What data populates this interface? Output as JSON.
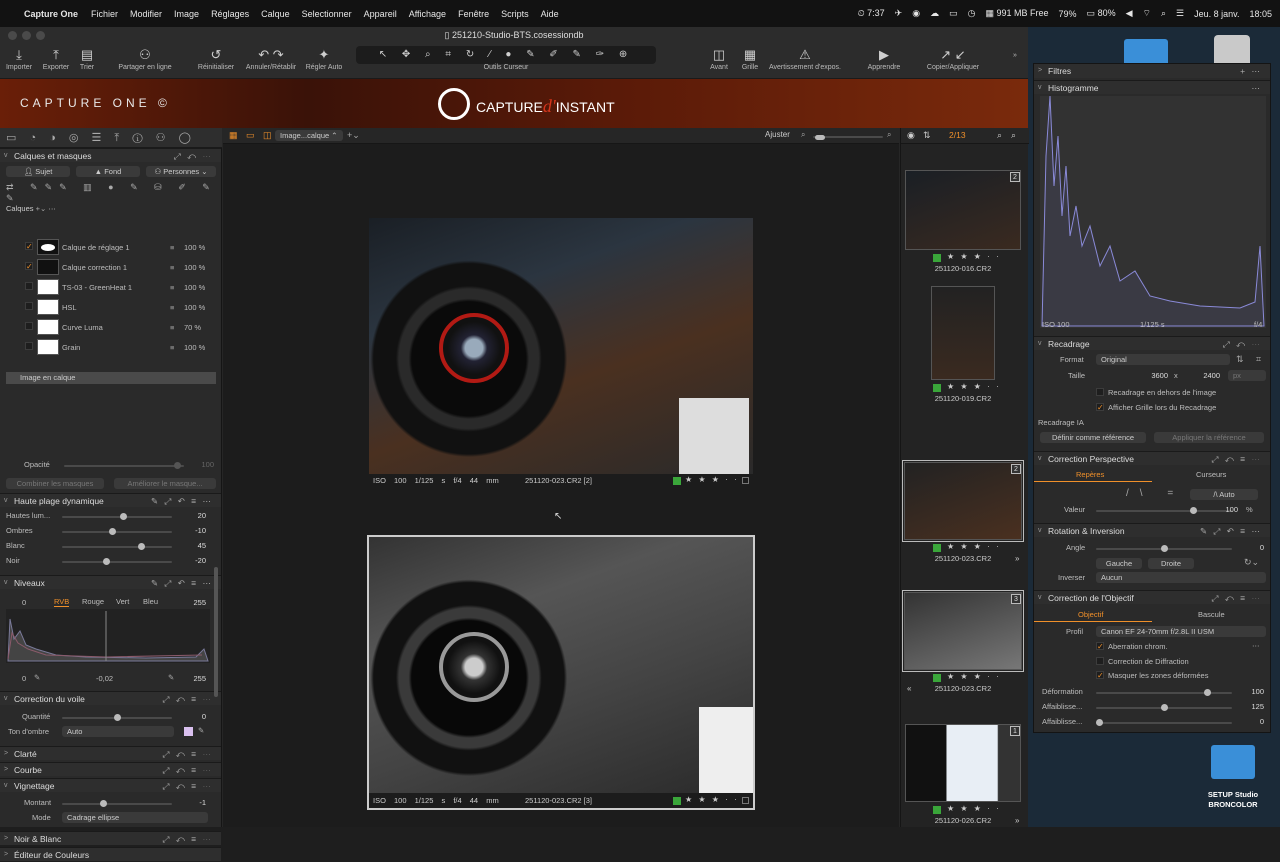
{
  "menubar": {
    "app": "Capture One",
    "items": [
      "Fichier",
      "Modifier",
      "Image",
      "Réglages",
      "Calque",
      "Selectionner",
      "Appareil",
      "Affichage",
      "Fenêtre",
      "Scripts",
      "Aide"
    ],
    "time_badge": "7:37",
    "memory": "991 MB Free",
    "cpu": "79%",
    "battery": "80%",
    "date": "Jeu. 8 janv.",
    "clock": "18:05"
  },
  "window": {
    "title": "251210-Studio-BTS.cosessiondb"
  },
  "toolbar": {
    "importer": "Importer",
    "exporter": "Exporter",
    "trier": "Trier",
    "partager": "Partager en ligne",
    "reinitialiser": "Réinitialiser",
    "annuler": "Annuler/Rétablir",
    "regler": "Régler Auto",
    "outils": "Outils Curseur",
    "avant": "Avant",
    "grille": "Grille",
    "avert": "Avertissement d'expos.",
    "apprendre": "Apprendre",
    "copier": "Copier/Appliquer"
  },
  "banner": {
    "left": "CAPTURE ONE",
    "center_a": "CAPTURE",
    "center_b": "d'",
    "center_c": "INSTANT"
  },
  "left": {
    "layers_title": "Calques et masques",
    "sujet": "Sujet",
    "fond": "Fond",
    "personnes": "Personnes",
    "calques": "Calques",
    "layers": [
      {
        "name": "Calque de réglage 1",
        "op": "100 %",
        "checked": "✓"
      },
      {
        "name": "Calque correction 1",
        "op": "100 %",
        "checked": "✓"
      },
      {
        "name": "TS-03 - GreenHeat 1",
        "op": "100 %",
        "checked": ""
      },
      {
        "name": "HSL",
        "op": "100 %",
        "checked": ""
      },
      {
        "name": "Curve Luma",
        "op": "70 %",
        "checked": ""
      },
      {
        "name": "Grain",
        "op": "100 %",
        "checked": ""
      }
    ],
    "image_layer": "Image en calque",
    "opacite": "Opacité",
    "opacite_val": "100",
    "combiner": "Combiner les masques",
    "ameliorer": "Améliorer le masque...",
    "hdr": {
      "title": "Haute plage dynamique",
      "rows": [
        {
          "label": "Hautes lum...",
          "val": "20",
          "pos": 0.55
        },
        {
          "label": "Ombres",
          "val": "-10",
          "pos": 0.45
        },
        {
          "label": "Blanc",
          "val": "45",
          "pos": 0.72
        },
        {
          "label": "Noir",
          "val": "-20",
          "pos": 0.4
        }
      ]
    },
    "niveaux": {
      "title": "Niveaux",
      "left": "0",
      "right": "255",
      "tabs": [
        "RVB",
        "Rouge",
        "Vert",
        "Bleu"
      ],
      "bottom_left": "0",
      "bottom_mid": "-0,02",
      "bottom_right": "255"
    },
    "voile": {
      "title": "Correction du voile",
      "quantite": "Quantité",
      "quantite_val": "0",
      "ton": "Ton d'ombre",
      "ton_val": "Auto"
    },
    "clarte": "Clarté",
    "courbe": "Courbe",
    "vignettage": {
      "title": "Vignettage",
      "montant": "Montant",
      "montant_val": "-1",
      "mode": "Mode",
      "mode_val": "Cadrage ellipse"
    },
    "noir": "Noir & Blanc",
    "editeur": "Éditeur de Couleurs"
  },
  "viewer": {
    "view_name": "Image...calque",
    "ajuster": "Ajuster",
    "img1": {
      "iso": "ISO 100",
      "speed": "1/125 s",
      "aperture": "f/4",
      "focal": "44 mm",
      "file": "251120-023.CR2 [2]",
      "stars": "★ ★ ★ ·  ·"
    },
    "img2": {
      "iso": "ISO 100",
      "speed": "1/125 s",
      "aperture": "f/4",
      "focal": "44 mm",
      "file": "251120-023.CR2 [3]",
      "stars": "★ ★ ★ ·  ·"
    }
  },
  "browser": {
    "count": "2/13",
    "thumbs": [
      {
        "name": "251120-016.CR2",
        "badge": "2"
      },
      {
        "name": "251120-019.CR2",
        "badge": ""
      },
      {
        "name": "251120-023.CR2",
        "badge": "2"
      },
      {
        "name": "251120-023.CR2",
        "badge": "3"
      },
      {
        "name": "251120-026.CR2",
        "badge": "1"
      }
    ],
    "stars": "★ ★ ★ ·  ·"
  },
  "right": {
    "filtres": "Filtres",
    "histogramme": "Histogramme",
    "iso": "ISO 100",
    "speed": "1/125 s",
    "aperture": "f/4",
    "recadrage": {
      "title": "Recadrage",
      "format": "Format",
      "format_val": "Original",
      "taille": "Taille",
      "w": "3600",
      "x": "x",
      "h": "2400",
      "unit": "px",
      "opt1": "Recadrage en dehors de l'image",
      "opt2": "Afficher Grille lors du Recadrage",
      "ia": "Recadrage IA",
      "def": "Définir comme référence",
      "app": "Appliquer la référence"
    },
    "perspective": {
      "title": "Correction Perspective",
      "tab1": "Repères",
      "tab2": "Curseurs",
      "auto": "Auto",
      "valeur": "Valeur",
      "valeur_val": "100",
      "pct": "%"
    },
    "rotation": {
      "title": "Rotation & Inversion",
      "angle": "Angle",
      "angle_val": "0",
      "gauche": "Gauche",
      "droite": "Droite",
      "inverser": "Inverser",
      "inverser_val": "Aucun"
    },
    "objectif": {
      "title": "Correction de l'Objectif",
      "tab1": "Objectif",
      "tab2": "Bascule",
      "profil": "Profil",
      "profil_val": "Canon EF 24-70mm f/2.8L II USM",
      "o1": "Aberration chrom.",
      "o2": "Correction de Diffraction",
      "o3": "Masquer les zones déformées",
      "def": "Déformation",
      "def_val": "100",
      "aff1": "Affaiblisse...",
      "aff1_val": "125",
      "aff2": "Affaiblisse...",
      "aff2_val": "0"
    }
  },
  "desktop": {
    "folder_label_1": "SETUP Studio",
    "folder_label_2": "BRONCOLOR"
  }
}
